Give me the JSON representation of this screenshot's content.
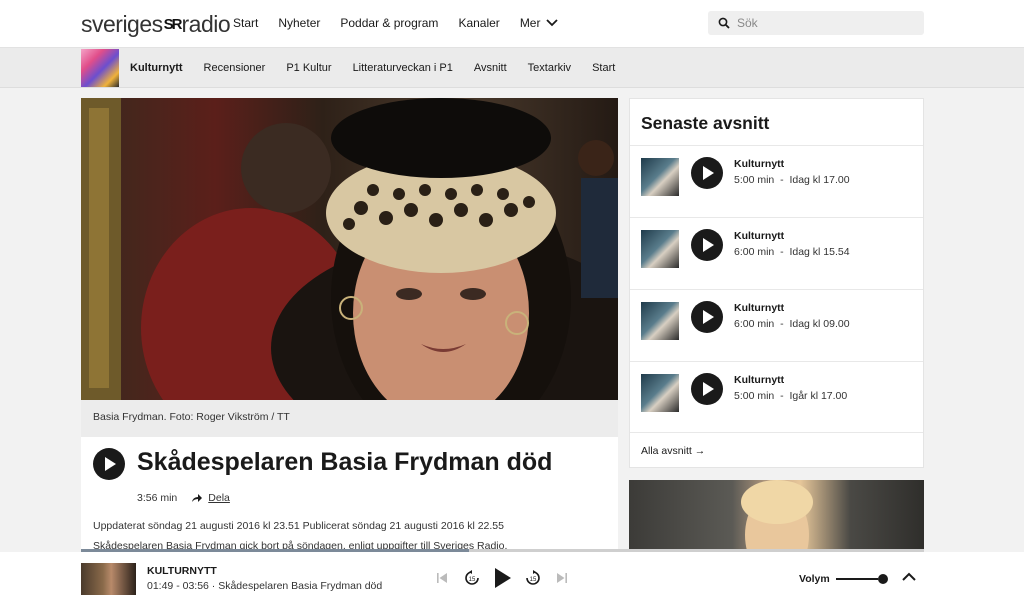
{
  "header": {
    "logo_left": "sveriges",
    "logo_mark": "SR",
    "logo_right": "radio",
    "nav": [
      "Start",
      "Nyheter",
      "Poddar & program",
      "Kanaler"
    ],
    "more_label": "Mer",
    "search_placeholder": "Sök"
  },
  "program_nav": {
    "active": "Kulturnytt",
    "items": [
      "Recensioner",
      "P1 Kultur",
      "Litteraturveckan i P1",
      "Avsnitt",
      "Textarkiv",
      "Start"
    ]
  },
  "article": {
    "caption": "Basia Frydman. Foto: Roger Vikström / TT",
    "title": "Skådespelaren Basia Frydman död",
    "duration": "3:56 min",
    "share_label": "Dela",
    "dates": "Uppdaterat söndag 21 augusti 2016 kl 23.51  Publicerat söndag 21 augusti 2016 kl 22.55",
    "lead": "Skådespelaren Basia Frydman gick bort på söndagen, enligt uppgifter till Sveriges Radio."
  },
  "latest": {
    "title": "Senaste avsnitt",
    "episodes": [
      {
        "name": "Kulturnytt",
        "length": "5:00 min",
        "when": "Idag kl 17.00"
      },
      {
        "name": "Kulturnytt",
        "length": "6:00 min",
        "when": "Idag kl 15.54"
      },
      {
        "name": "Kulturnytt",
        "length": "6:00 min",
        "when": "Idag kl 09.00"
      },
      {
        "name": "Kulturnytt",
        "length": "5:00 min",
        "when": "Igår kl 17.00"
      }
    ],
    "all_label": "Alla avsnitt"
  },
  "player": {
    "title": "KULTURNYTT",
    "subtitle": "01:49 - 03:56 · Skådespelaren Basia Frydman död",
    "volume_label": "Volym",
    "progress_fraction": 0.46,
    "volume_fraction": 0.9
  }
}
